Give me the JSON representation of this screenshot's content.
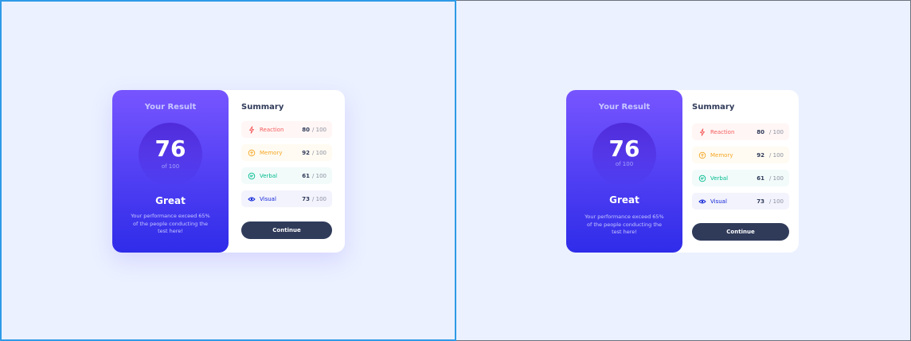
{
  "panels": [
    {
      "result_title": "Your Result",
      "score": "76",
      "score_of": "of 100",
      "rating": "Great",
      "description": "Your performance exceed 65% of the people conducting the test here!",
      "summary_title": "Summary",
      "items": [
        {
          "label": "Reaction",
          "value": "80",
          "total": "/ 100",
          "icon": "lightning-icon",
          "color": "#f55c5c",
          "bg": "#fff6f5"
        },
        {
          "label": "Memory",
          "value": "92",
          "total": "/ 100",
          "icon": "brain-icon",
          "color": "#f5a623",
          "bg": "#fffbf2"
        },
        {
          "label": "Verbal",
          "value": "61",
          "total": "/ 100",
          "icon": "chat-icon",
          "color": "#00bb8f",
          "bg": "#f2fbfa"
        },
        {
          "label": "Visual",
          "value": "73",
          "total": "/ 100",
          "icon": "eye-icon",
          "color": "#1125d6",
          "bg": "#f3f3fd"
        }
      ],
      "continue_label": "Continue"
    },
    {
      "result_title": "Your Result",
      "score": "76",
      "score_of": "of 100",
      "rating": "Great",
      "description": "Your performance exceed 65% of the people conducting the test here!",
      "summary_title": "Summary",
      "items": [
        {
          "label": "Reaction",
          "value": "80",
          "total": "/ 100",
          "icon": "lightning-icon",
          "color": "#f55c5c",
          "bg": "#fff6f5"
        },
        {
          "label": "Memory",
          "value": "92",
          "total": "/ 100",
          "icon": "brain-icon",
          "color": "#f5a623",
          "bg": "#fffbf2"
        },
        {
          "label": "Verbal",
          "value": "61",
          "total": "/ 100",
          "icon": "chat-icon",
          "color": "#00bb8f",
          "bg": "#f2fbfa"
        },
        {
          "label": "Visual",
          "value": "73",
          "total": "/ 100",
          "icon": "eye-icon",
          "color": "#1125d6",
          "bg": "#f3f3fd"
        }
      ],
      "continue_label": "Continue"
    }
  ]
}
